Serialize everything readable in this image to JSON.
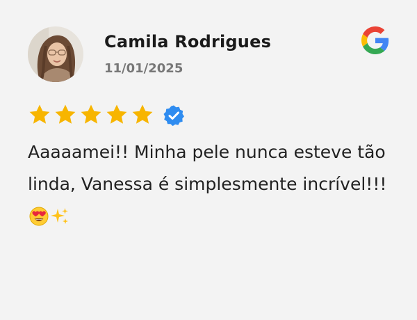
{
  "review": {
    "author_name": "Camila Rodrigues",
    "date": "11/01/2025",
    "rating": 5,
    "max_rating": 5,
    "text": "Aaaaamei!! Minha pele nunca esteve tão linda, Vanessa é simplesmente incrível!!!",
    "emojis": [
      "heart-eyes-emoji",
      "sparkles-emoji"
    ],
    "verified": true
  },
  "icons": {
    "source": "google-icon",
    "verified": "verified-badge-icon",
    "star": "star-icon"
  },
  "colors": {
    "background": "#f3f3f3",
    "star": "#f7b500",
    "verified": "#2f8cf0",
    "name": "#1a1a1a",
    "date": "#777777",
    "text": "#222222"
  }
}
